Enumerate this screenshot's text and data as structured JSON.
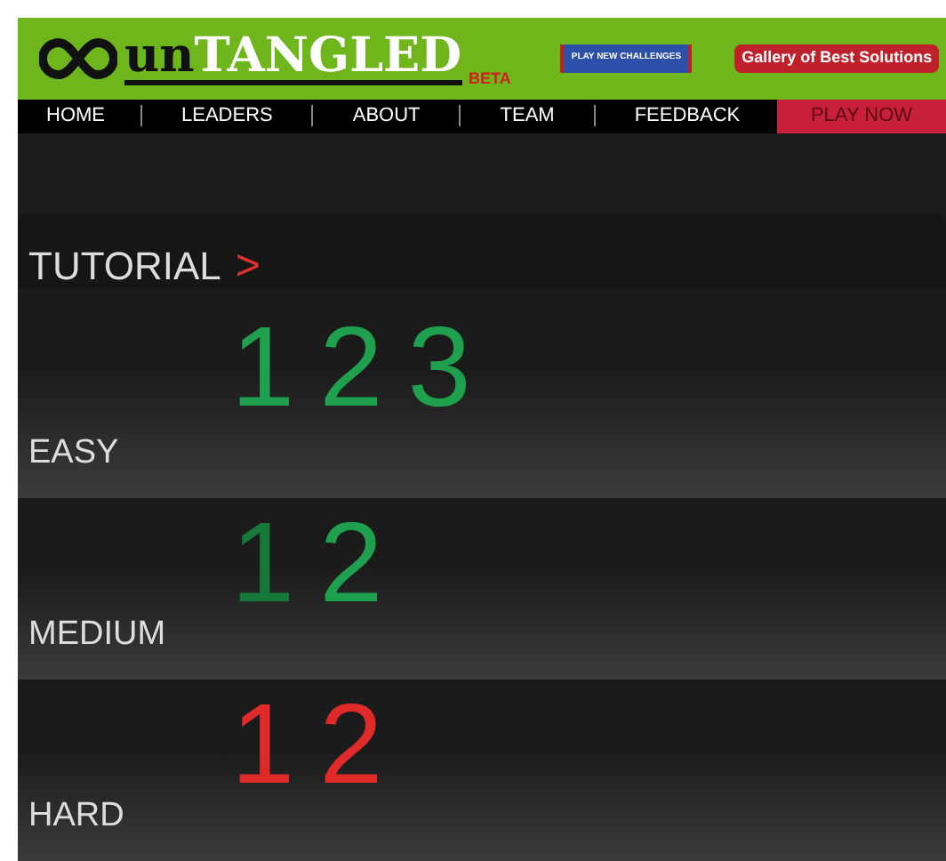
{
  "header": {
    "logo_prefix": "un",
    "logo_word": "TANGLED",
    "badge": "BETA",
    "play_button": "PLAY NEW CHALLENGES",
    "gallery": "Gallery of Best Solutions"
  },
  "nav": {
    "items": [
      {
        "label": "HOME"
      },
      {
        "label": "LEADERS"
      },
      {
        "label": "ABOUT"
      },
      {
        "label": "TEAM"
      },
      {
        "label": "FEEDBACK"
      }
    ],
    "play_now": "PLAY NOW"
  },
  "tutorial": {
    "label": "TUTORIAL",
    "arrow": ">"
  },
  "levels": [
    {
      "name": "EASY",
      "puzzles": [
        {
          "label": "1",
          "color": "#1fa04f"
        },
        {
          "label": "2",
          "color": "#1fa04f"
        },
        {
          "label": "3",
          "color": "#1fa04f"
        }
      ]
    },
    {
      "name": "MEDIUM",
      "puzzles": [
        {
          "label": "1",
          "color": "#16793a"
        },
        {
          "label": "2",
          "color": "#1fa04f"
        }
      ]
    },
    {
      "name": "HARD",
      "puzzles": [
        {
          "label": "1",
          "color": "#e02a2a"
        },
        {
          "label": "2",
          "color": "#e02a2a"
        }
      ]
    }
  ]
}
